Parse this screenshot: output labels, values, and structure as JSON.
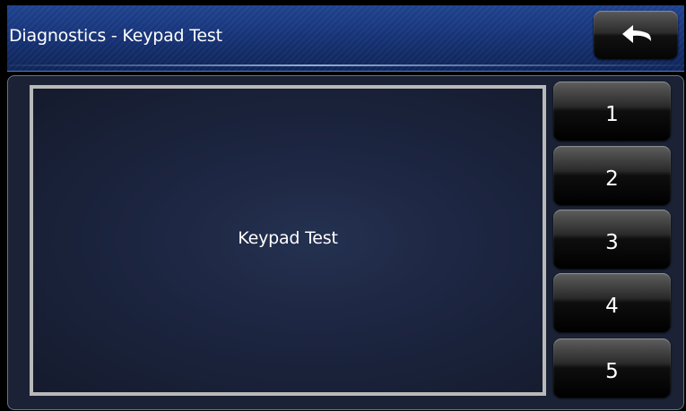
{
  "header": {
    "title": "Diagnostics - Keypad Test",
    "back_icon": "back-arrow-icon"
  },
  "display": {
    "text": "Keypad Test"
  },
  "keypad": {
    "keys": [
      {
        "label": "1"
      },
      {
        "label": "2"
      },
      {
        "label": "3"
      },
      {
        "label": "4"
      },
      {
        "label": "5"
      }
    ]
  },
  "colors": {
    "header_blue": "#173478",
    "panel_background": "#1b2235",
    "display_border": "#b9b9b9",
    "button_black": "#000000",
    "text": "#ffffff"
  }
}
